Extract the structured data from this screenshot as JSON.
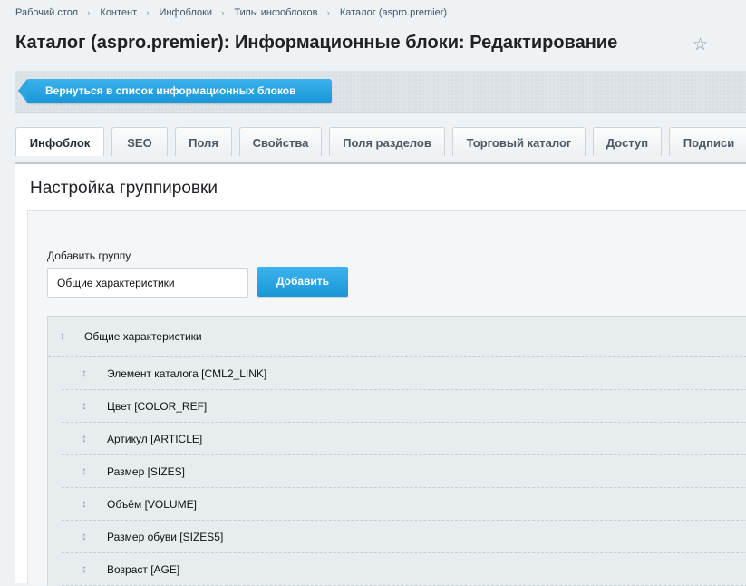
{
  "breadcrumbs": [
    "Рабочий стол",
    "Контент",
    "Инфоблоки",
    "Типы инфоблоков",
    "Каталог (aspro.premier)"
  ],
  "breadcrumb_separator": "›",
  "page": {
    "title": "Каталог (aspro.premier): Информационные блоки: Редактирование",
    "star_glyph": "☆"
  },
  "back_button_label": "Вернуться в список информационных блоков",
  "tabs": [
    "Инфоблок",
    "SEO",
    "Поля",
    "Свойства",
    "Поля разделов",
    "Торговый каталог",
    "Доступ",
    "Подписи"
  ],
  "active_tab": "Инфоблок",
  "section": {
    "title": "Настройка группировки",
    "add_group_label": "Добавить группу",
    "add_group_value": "Общие характеристики",
    "add_button_label": "Добавить"
  },
  "drag_glyph": "↕",
  "group": {
    "label": "Общие характеристики",
    "properties": [
      "Элемент каталога [CML2_LINK]",
      "Цвет [COLOR_REF]",
      "Артикул [ARTICLE]",
      "Размер [SIZES]",
      "Объём [VOLUME]",
      "Размер обуви [SIZES5]",
      "Возраст [AGE]"
    ]
  },
  "colors": {
    "accent_blue": "#1a96d6",
    "page_background": "#eef2f4"
  }
}
